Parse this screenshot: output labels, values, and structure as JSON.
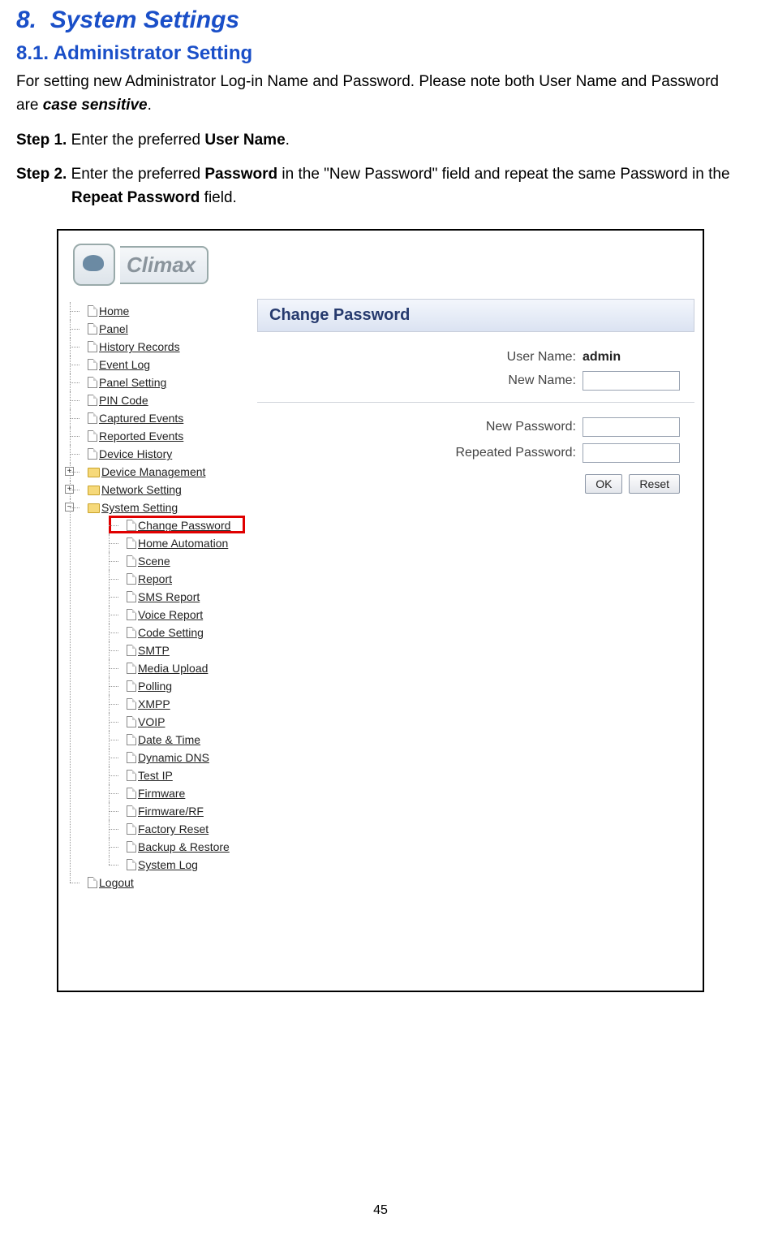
{
  "doc": {
    "title_num": "8.",
    "title_text": "System Settings",
    "subtitle": "8.1. Administrator Setting",
    "intro_1": "For setting new Administrator Log-in Name and Password. Please note both User Name and Password are ",
    "intro_case": "case sensitive",
    "intro_2": ".",
    "step1_label": "Step 1.",
    "step1_a": " Enter the preferred ",
    "step1_b": "User Name",
    "step1_c": ".",
    "step2_label": "Step 2.",
    "step2_a": " Enter the preferred ",
    "step2_b": "Password",
    "step2_c": " in the \"New Password\" field and repeat the same Password in the ",
    "step2_d": "Repeat Password",
    "step2_e": " field.",
    "page_number": "45"
  },
  "logo_text": "Climax",
  "panel_title": "Change Password",
  "form": {
    "user_name_label": "User Name:",
    "user_name_value": "admin",
    "new_name_label": "New Name:",
    "new_password_label": "New Password:",
    "repeated_password_label": "Repeated Password:",
    "ok_label": "OK",
    "reset_label": "Reset"
  },
  "nav": {
    "home": "Home",
    "panel": "Panel",
    "history_records": "History Records",
    "event_log": "Event Log",
    "panel_setting": "Panel Setting",
    "pin_code": "PIN Code",
    "captured_events": "Captured Events",
    "reported_events": "Reported Events",
    "device_history": "Device History",
    "device_management": "Device Management",
    "network_setting": "Network Setting",
    "system_setting": "System Setting",
    "change_password": "Change Password",
    "home_automation": "Home Automation",
    "scene": "Scene",
    "report": "Report",
    "sms_report": "SMS Report",
    "voice_report": "Voice Report",
    "code_setting": "Code Setting",
    "smtp": "SMTP",
    "media_upload": "Media Upload",
    "polling": "Polling",
    "xmpp": "XMPP",
    "voip": "VOIP",
    "date_time": "Date & Time",
    "dynamic_dns": "Dynamic DNS",
    "test_ip": "Test IP",
    "firmware": "Firmware",
    "firmware_rf": "Firmware/RF",
    "factory_reset": "Factory Reset",
    "backup_restore": "Backup & Restore",
    "system_log": "System Log",
    "logout": "Logout"
  },
  "expander_plus": "+",
  "expander_minus": "−"
}
